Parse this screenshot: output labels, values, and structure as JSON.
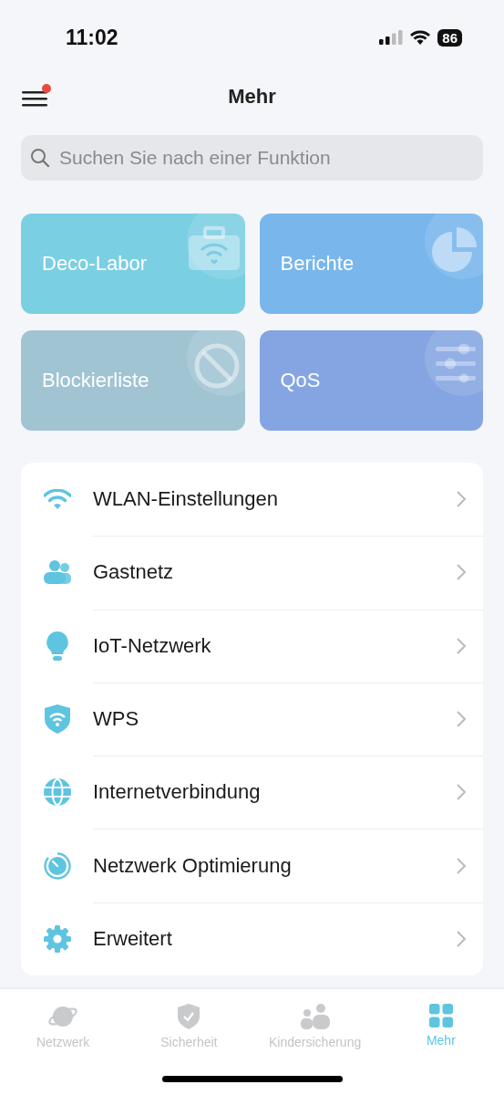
{
  "status_bar": {
    "time": "11:02",
    "battery": "86"
  },
  "header": {
    "title": "Mehr",
    "menu_badge": true
  },
  "search": {
    "placeholder": "Suchen Sie nach einer Funktion"
  },
  "tiles": [
    {
      "label": "Deco-Labor",
      "kind": "lab",
      "color": "#7bcfe3"
    },
    {
      "label": "Berichte",
      "kind": "report",
      "color": "#78b6ec"
    },
    {
      "label": "Blockierliste",
      "kind": "block",
      "color": "#a1c4d3"
    },
    {
      "label": "QoS",
      "kind": "qos",
      "color": "#85a5e2"
    }
  ],
  "menu_items": [
    {
      "label": "WLAN-Einstellungen",
      "kind": "wifi"
    },
    {
      "label": "Gastnetz",
      "kind": "guests"
    },
    {
      "label": "IoT-Netzwerk",
      "kind": "bulb"
    },
    {
      "label": "WPS",
      "kind": "shield"
    },
    {
      "label": "Internetverbindung",
      "kind": "globe"
    },
    {
      "label": "Netzwerk Optimierung",
      "kind": "timer"
    },
    {
      "label": "Erweitert",
      "kind": "gear"
    }
  ],
  "tab_bar": [
    {
      "label": "Netzwerk",
      "kind": "planet",
      "selected": false
    },
    {
      "label": "Sicherheit",
      "kind": "shield",
      "selected": false
    },
    {
      "label": "Kindersicherung",
      "kind": "family",
      "selected": false
    },
    {
      "label": "Mehr",
      "kind": "grid",
      "selected": true
    }
  ]
}
